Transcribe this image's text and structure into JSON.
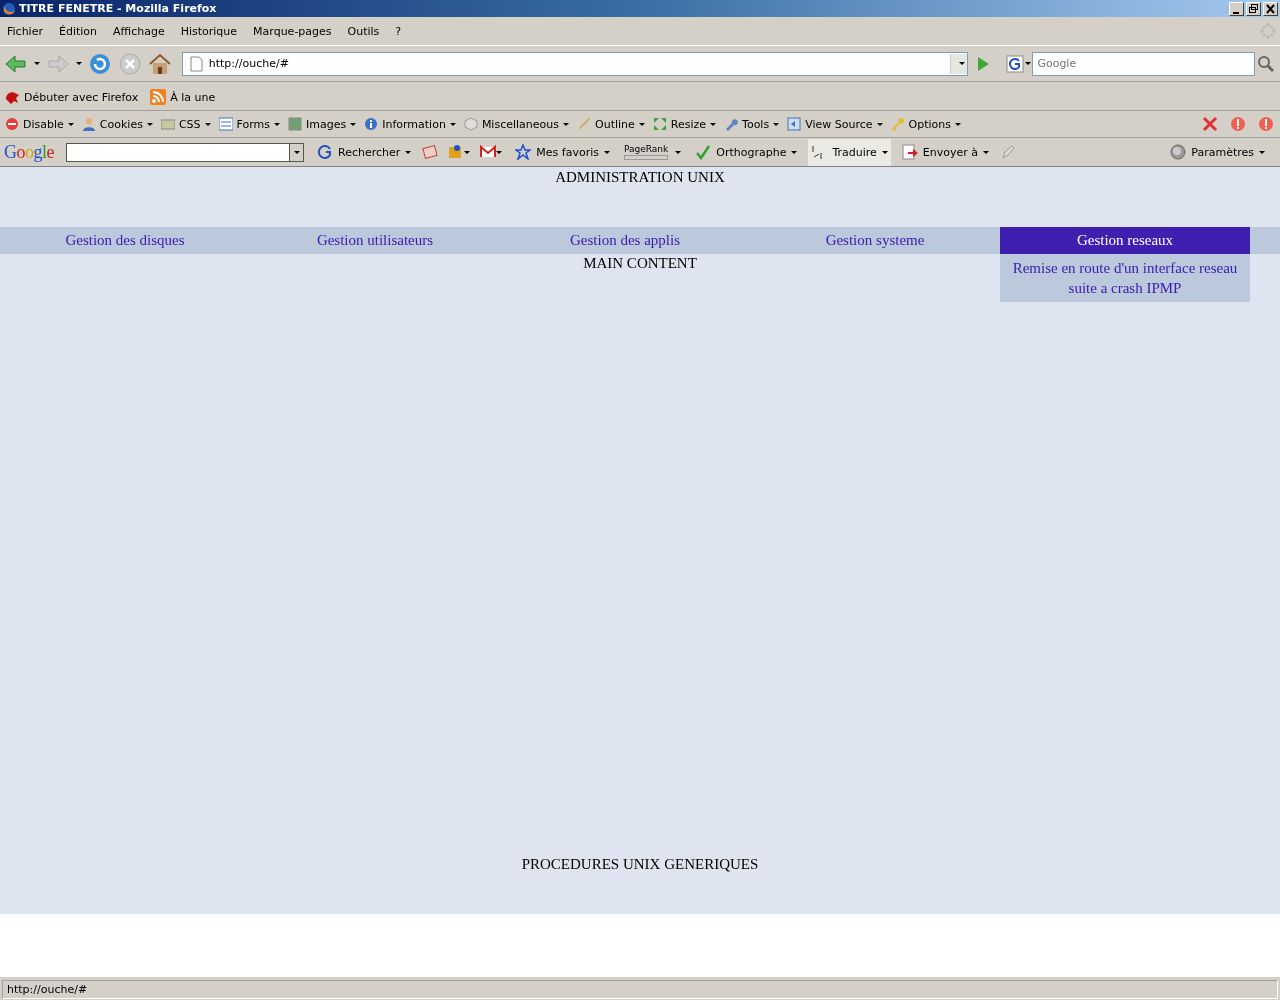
{
  "window": {
    "title": "TITRE FENETRE - Mozilla Firefox"
  },
  "menu": [
    "Fichier",
    "Édition",
    "Affichage",
    "Historique",
    "Marque-pages",
    "Outils",
    "?"
  ],
  "navigation": {
    "url": "http://ouche/#",
    "search_placeholder": "Google"
  },
  "bookmarks": [
    "Débuter avec Firefox",
    "À la une"
  ],
  "webdev_toolbar": [
    "Disable",
    "Cookies",
    "CSS",
    "Forms",
    "Images",
    "Information",
    "Miscellaneous",
    "Outline",
    "Resize",
    "Tools",
    "View Source",
    "Options"
  ],
  "google_toolbar": {
    "logo": "Google",
    "search_label": "Rechercher",
    "favorites": "Mes favoris",
    "pagerank": "PageRank",
    "spelling": "Orthographe",
    "translate": "Traduire",
    "send": "Envoyer à",
    "settings": "Paramètres"
  },
  "page": {
    "header": "ADMINISTRATION UNIX",
    "tabs": [
      {
        "label": "Gestion des disques",
        "selected": false
      },
      {
        "label": "Gestion utilisateurs",
        "selected": false
      },
      {
        "label": "Gestion des applis",
        "selected": false
      },
      {
        "label": "Gestion systeme",
        "selected": false
      },
      {
        "label": "Gestion reseaux",
        "selected": true,
        "submenu": [
          "Remise en route d'un interface reseau suite a crash IPMP"
        ]
      }
    ],
    "main": "MAIN CONTENT",
    "footer": "PROCEDURES UNIX GENERIQUES"
  },
  "status_bar": "http://ouche/#"
}
